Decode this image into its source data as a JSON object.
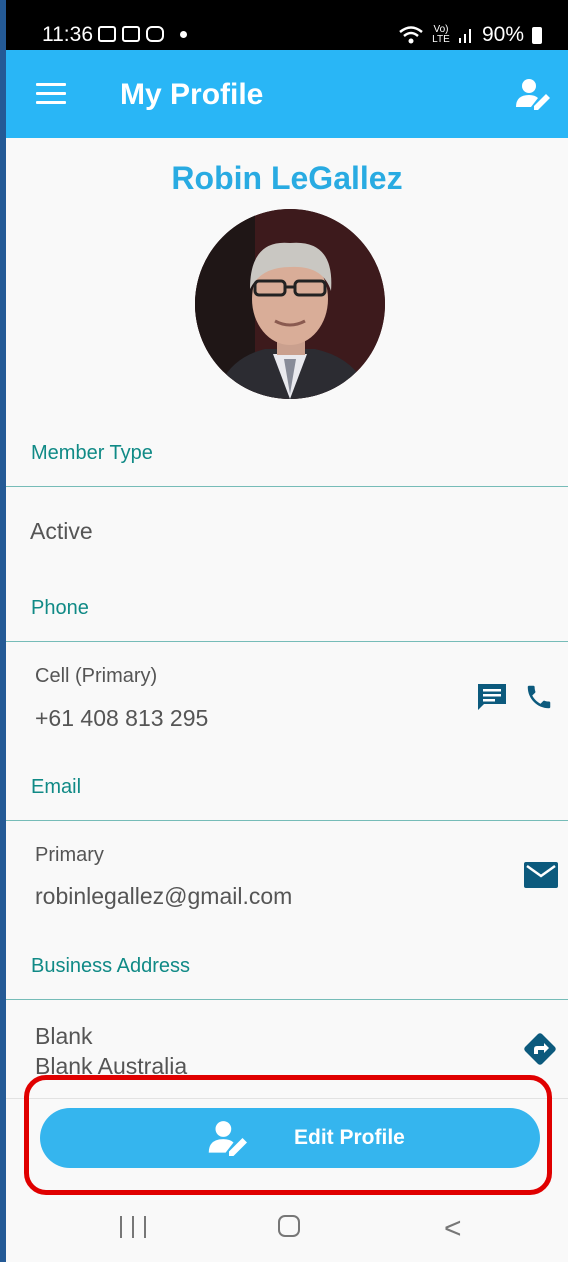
{
  "status_bar": {
    "time": "11:36",
    "network": "Vo) LTE",
    "battery": "90%"
  },
  "app_bar": {
    "title": "My Profile",
    "icons": [
      "menu-icon",
      "edit-profile-icon"
    ]
  },
  "profile": {
    "name": "Robin LeGallez"
  },
  "member_type": {
    "label": "Member Type",
    "value": "Active"
  },
  "phone": {
    "label": "Phone",
    "type": "Cell (Primary)",
    "number": "+61 408 813 295"
  },
  "email": {
    "label": "Email",
    "type": "Primary",
    "address": "robinlegallez@gmail.com"
  },
  "business_address": {
    "label": "Business Address",
    "line1": "Blank",
    "line2": "Blank Australia"
  },
  "edit_button": {
    "label": "Edit Profile"
  },
  "colors": {
    "accent": "#29b6f6",
    "section_label": "#108a86",
    "action_icons": "#0c5a7d",
    "highlight": "#e00000"
  }
}
